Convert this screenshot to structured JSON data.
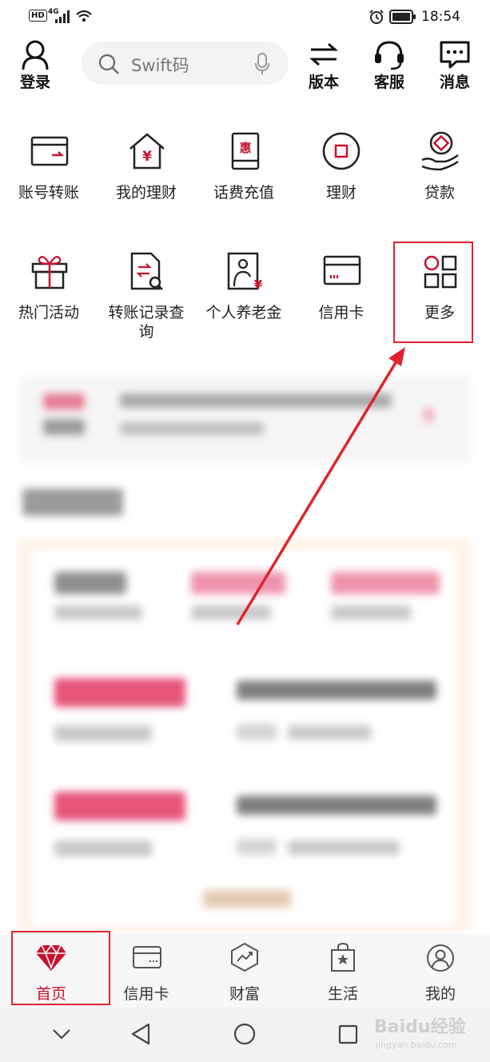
{
  "status_bar": {
    "hd": "HD",
    "network": "4G",
    "time": "18:54"
  },
  "header": {
    "login_label": "登录",
    "search_placeholder": "Swift码",
    "version_label": "版本",
    "service_label": "客服",
    "messages_label": "消息"
  },
  "grid_row1": [
    {
      "label": "账号转账",
      "icon": "transfer-card-icon"
    },
    {
      "label": "我的理财",
      "icon": "home-yen-icon"
    },
    {
      "label": "话费充值",
      "icon": "phone-recharge-icon"
    },
    {
      "label": "理财",
      "icon": "finance-circle-icon"
    },
    {
      "label": "贷款",
      "icon": "loan-hand-icon"
    }
  ],
  "grid_row2": [
    {
      "label": "热门活动",
      "icon": "gift-icon"
    },
    {
      "label_line1": "转账记录查",
      "label_line2": "询",
      "icon": "transfer-record-search-icon"
    },
    {
      "label": "个人养老金",
      "icon": "pension-icon"
    },
    {
      "label": "信用卡",
      "icon": "credit-card-icon"
    },
    {
      "label": "更多",
      "icon": "more-grid-icon"
    }
  ],
  "bottom_nav": [
    {
      "label": "首页",
      "icon": "diamond-home-icon",
      "active": true
    },
    {
      "label": "信用卡",
      "icon": "credit-card-icon"
    },
    {
      "label": "财富",
      "icon": "wealth-chart-icon"
    },
    {
      "label": "生活",
      "icon": "shopping-bag-icon"
    },
    {
      "label": "我的",
      "icon": "user-circle-icon"
    }
  ],
  "colors": {
    "accent": "#c8102e",
    "highlight": "#e0242c",
    "text": "#222222"
  },
  "watermark": {
    "brand": "Baidu经验",
    "url": "jingyan.baidu.com"
  }
}
